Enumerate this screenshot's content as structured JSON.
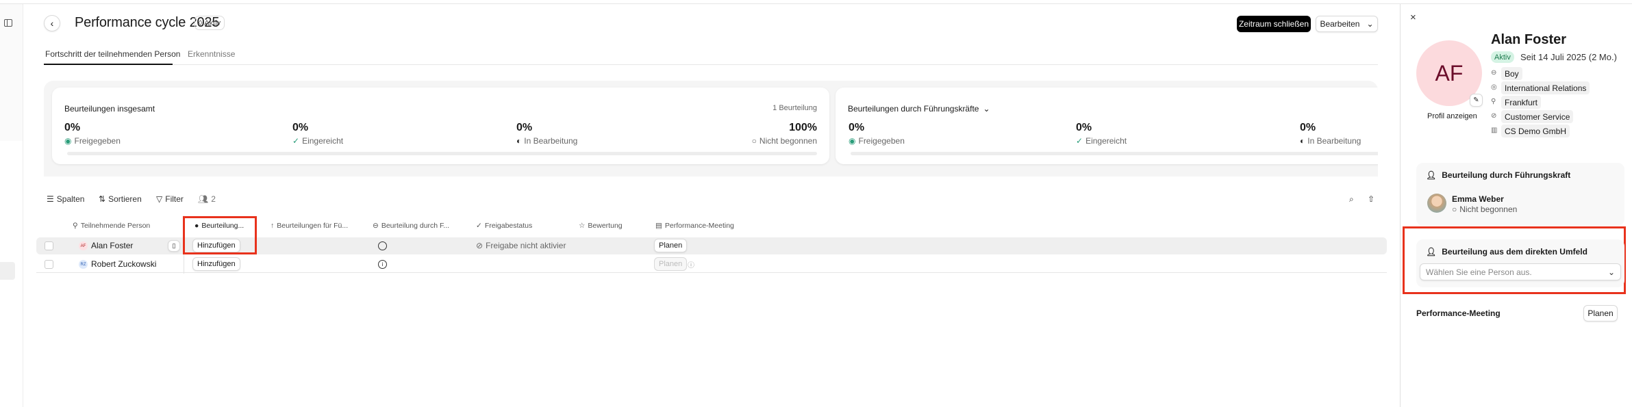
{
  "header": {
    "title": "Performance cycle 2025",
    "status": "Aktiv",
    "primary_button": "Zeitraum schließen",
    "edit_button": "Bearbeiten"
  },
  "tabs": [
    {
      "label": "Fortschritt der teilnehmenden Person",
      "active": true
    },
    {
      "label": "Erkenntnisse",
      "active": false
    }
  ],
  "stats": {
    "total": {
      "title": "Beurteilungen insgesamt",
      "count": "1 Beurteilung",
      "items": [
        {
          "value": "0%",
          "label": "Freigegeben"
        },
        {
          "value": "0%",
          "label": "Eingereicht"
        },
        {
          "value": "0%",
          "label": "In Bearbeitung"
        },
        {
          "value": "100%",
          "label": "Nicht begonnen"
        }
      ]
    },
    "managers": {
      "title": "Beurteilungen durch Führungskräfte",
      "items": [
        {
          "value": "0%",
          "label": "Freigegeben"
        },
        {
          "value": "0%",
          "label": "Eingereicht"
        },
        {
          "value": "0%",
          "label": "In Bearbeitung"
        }
      ]
    }
  },
  "toolbar": {
    "columns": "Spalten",
    "sort": "Sortieren",
    "filter": "Filter",
    "people_count": "2"
  },
  "table": {
    "headers": [
      "Teilnehmende Person",
      "Beurteilung...",
      "Beurteilungen für Fü...",
      "Beurteilung durch F...",
      "Freigabestatus",
      "Bewertung",
      "Performance-Meeting"
    ],
    "rows": [
      {
        "initials": "AF",
        "name": "Alan Foster",
        "add": "Hinzufügen",
        "release": "Freigabe nicht aktivier",
        "meeting": "Planen",
        "avatar_color": "#fde0e3"
      },
      {
        "initials": "RZ",
        "name": "Robert Zuckowski",
        "add": "Hinzufügen",
        "release": "",
        "meeting": "Planen",
        "avatar_color": "#dde9fb"
      }
    ]
  },
  "panel": {
    "initials": "AF",
    "name": "Alan Foster",
    "status": "Aktiv",
    "since": "Seit 14 Juli 2025 (2 Mo.)",
    "profile_link": "Profil anzeigen",
    "attributes": [
      "Boy",
      "International Relations",
      "Frankfurt",
      "Customer Service",
      "CS Demo GmbH"
    ],
    "manager_section": {
      "title": "Beurteilung durch Führungskraft",
      "manager_name": "Emma Weber",
      "manager_status": "Nicht begonnen"
    },
    "peer_section": {
      "title": "Beurteilung aus dem direkten Umfeld",
      "placeholder": "Wählen Sie eine Person aus."
    },
    "meeting": {
      "title": "Performance-Meeting",
      "button": "Planen"
    }
  },
  "colors": {
    "accent": "#000000",
    "highlight": "#e8321c",
    "avatar_bg": "#fcdadd",
    "avatar_text": "#6b0d2a",
    "active_badge": "#d5f3e4"
  }
}
